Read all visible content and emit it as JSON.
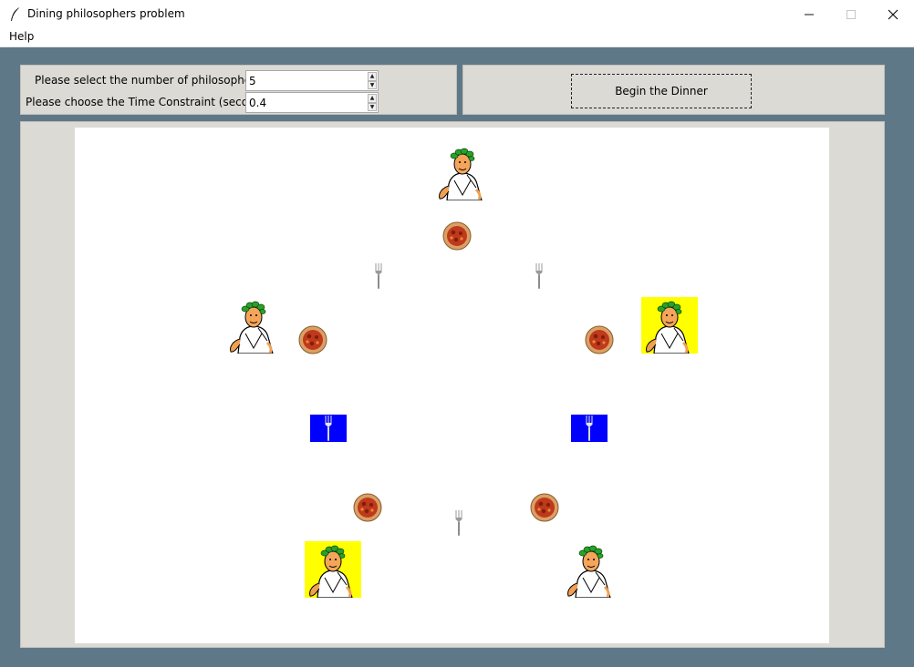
{
  "window": {
    "title": "Dining philosophers problem",
    "icon": "feather-icon",
    "min_icon": "minimize-icon",
    "max_icon": "maximize-icon",
    "close_icon": "close-icon"
  },
  "menu": {
    "items": [
      {
        "label": "Help"
      }
    ]
  },
  "controls": {
    "count_label": "Please select the number of philosophers:",
    "count_value": "5",
    "time_label": "Please choose the Time Constraint (seconds):",
    "time_value": "0.4"
  },
  "action": {
    "begin_label": "Begin the Dinner"
  },
  "scene": {
    "philosophers": [
      {
        "name": "philosopher-1",
        "highlighted": false
      },
      {
        "name": "philosopher-2",
        "highlighted": false
      },
      {
        "name": "philosopher-3",
        "highlighted": true
      },
      {
        "name": "philosopher-4",
        "highlighted": true
      },
      {
        "name": "philosopher-5",
        "highlighted": false
      }
    ],
    "forks": [
      {
        "name": "fork-1",
        "in_use": false
      },
      {
        "name": "fork-2",
        "in_use": false
      },
      {
        "name": "fork-3",
        "in_use": true
      },
      {
        "name": "fork-4",
        "in_use": true
      },
      {
        "name": "fork-5",
        "in_use": false
      }
    ],
    "colors": {
      "highlight": "#ffff00",
      "fork_in_use": "#0000ff"
    }
  }
}
